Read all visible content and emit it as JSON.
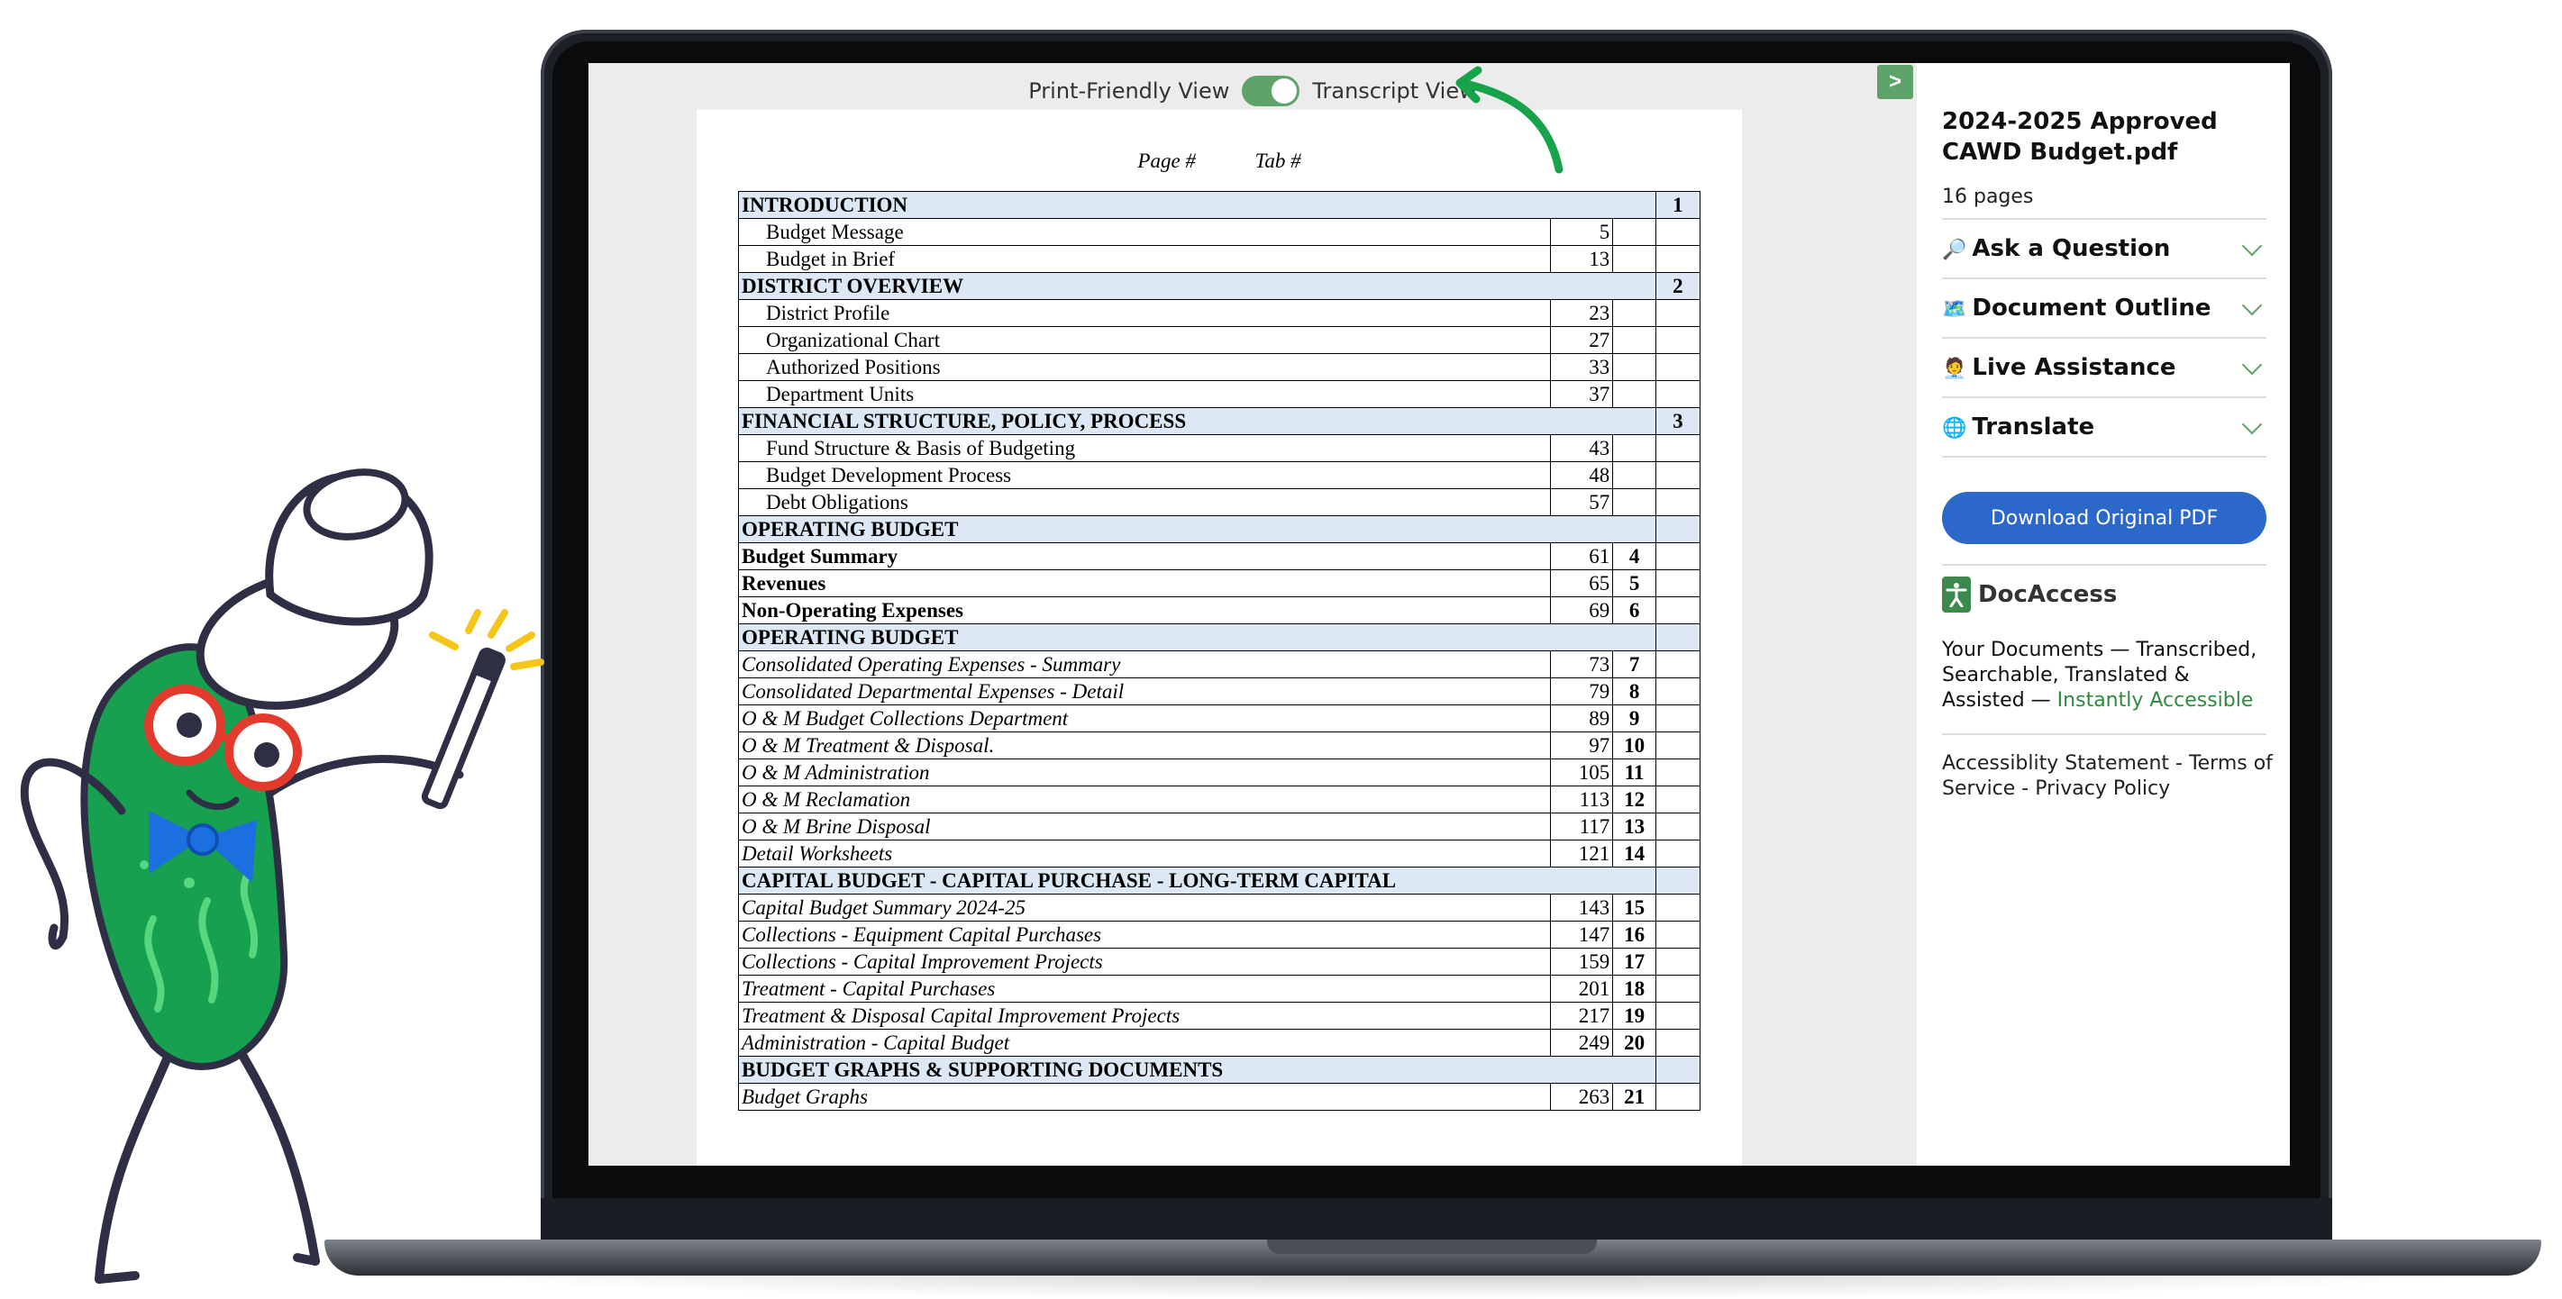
{
  "viewer": {
    "toggle_left": "Print-Friendly View",
    "toggle_right": "Transcript View",
    "collapse_label": ">"
  },
  "document": {
    "head_page": "Page #",
    "head_tab": "Tab #",
    "rows": [
      {
        "title": "INTRODUCTION",
        "page": "",
        "tab": "1",
        "kind": "section"
      },
      {
        "title": "Budget Message",
        "page": "5",
        "tab": "",
        "kind": "sub"
      },
      {
        "title": "Budget in Brief",
        "page": "13",
        "tab": "",
        "kind": "sub"
      },
      {
        "title": "DISTRICT OVERVIEW",
        "page": "",
        "tab": "2",
        "kind": "section"
      },
      {
        "title": "District Profile",
        "page": "23",
        "tab": "",
        "kind": "sub"
      },
      {
        "title": "Organizational Chart",
        "page": "27",
        "tab": "",
        "kind": "sub"
      },
      {
        "title": "Authorized Positions",
        "page": "33",
        "tab": "",
        "kind": "sub"
      },
      {
        "title": "Department Units",
        "page": "37",
        "tab": "",
        "kind": "sub"
      },
      {
        "title": "FINANCIAL STRUCTURE, POLICY, PROCESS",
        "page": "",
        "tab": "3",
        "kind": "section"
      },
      {
        "title": "Fund Structure & Basis of Budgeting",
        "page": "43",
        "tab": "",
        "kind": "sub"
      },
      {
        "title": "Budget Development Process",
        "page": "48",
        "tab": "",
        "kind": "sub"
      },
      {
        "title": "Debt Obligations",
        "page": "57",
        "tab": "",
        "kind": "sub"
      },
      {
        "title": "OPERATING BUDGET",
        "page": "",
        "tab": "",
        "kind": "section"
      },
      {
        "title": "Budget Summary",
        "page": "61",
        "tab": "4",
        "kind": "bold"
      },
      {
        "title": "Revenues",
        "page": "65",
        "tab": "5",
        "kind": "bold"
      },
      {
        "title": "Non-Operating Expenses",
        "page": "69",
        "tab": "6",
        "kind": "bold"
      },
      {
        "title": "OPERATING BUDGET",
        "page": "",
        "tab": "",
        "kind": "section"
      },
      {
        "title": "Consolidated Operating Expenses - Summary",
        "page": "73",
        "tab": "7",
        "kind": "ital"
      },
      {
        "title": "Consolidated Departmental Expenses - Detail",
        "page": "79",
        "tab": "8",
        "kind": "ital"
      },
      {
        "title": "O & M Budget Collections Department",
        "page": "89",
        "tab": "9",
        "kind": "ital"
      },
      {
        "title": "O & M Treatment & Disposal.",
        "page": "97",
        "tab": "10",
        "kind": "ital"
      },
      {
        "title": "O & M Administration",
        "page": "105",
        "tab": "11",
        "kind": "ital"
      },
      {
        "title": "O & M Reclamation",
        "page": "113",
        "tab": "12",
        "kind": "ital"
      },
      {
        "title": "O & M Brine Disposal",
        "page": "117",
        "tab": "13",
        "kind": "ital"
      },
      {
        "title": "Detail Worksheets",
        "page": "121",
        "tab": "14",
        "kind": "ital"
      },
      {
        "title": "CAPITAL BUDGET - CAPITAL PURCHASE - LONG-TERM CAPITAL",
        "page": "",
        "tab": "",
        "kind": "section"
      },
      {
        "title": "Capital Budget Summary 2024-25",
        "page": "143",
        "tab": "15",
        "kind": "ital"
      },
      {
        "title": "Collections - Equipment Capital Purchases",
        "page": "147",
        "tab": "16",
        "kind": "ital"
      },
      {
        "title": "Collections - Capital Improvement Projects",
        "page": "159",
        "tab": "17",
        "kind": "ital"
      },
      {
        "title": "Treatment - Capital Purchases",
        "page": "201",
        "tab": "18",
        "kind": "ital"
      },
      {
        "title": "Treatment & Disposal Capital Improvement Projects",
        "page": "217",
        "tab": "19",
        "kind": "ital"
      },
      {
        "title": "Administration - Capital Budget",
        "page": "249",
        "tab": "20",
        "kind": "ital"
      },
      {
        "title": "BUDGET GRAPHS & SUPPORTING DOCUMENTS",
        "page": "",
        "tab": "",
        "kind": "section"
      },
      {
        "title": "Budget Graphs",
        "page": "263",
        "tab": "21",
        "kind": "ital"
      }
    ]
  },
  "side": {
    "title": "2024-2025 Approved CAWD Budget.pdf",
    "pages": "16 pages",
    "accordions": [
      {
        "icon": "🔎",
        "label": "Ask a Question"
      },
      {
        "icon": "🗺️",
        "label": "Document Outline"
      },
      {
        "icon": "🧑‍💼",
        "label": "Live Assistance"
      },
      {
        "icon": "🌐",
        "label": "Translate"
      }
    ],
    "download": "Download Original PDF",
    "brand": "DocAccess",
    "tagline_main": "Your Documents — Transcribed, Searchable, Translated & Assisted — ",
    "tagline_accent": "Instantly Accessible",
    "footer": "Accessiblity Statement - Terms of Service - Privacy Policy"
  },
  "colors": {
    "accent_green": "#5fa26a",
    "button_blue": "#2c68c9",
    "section_blue": "#dce8f4"
  }
}
